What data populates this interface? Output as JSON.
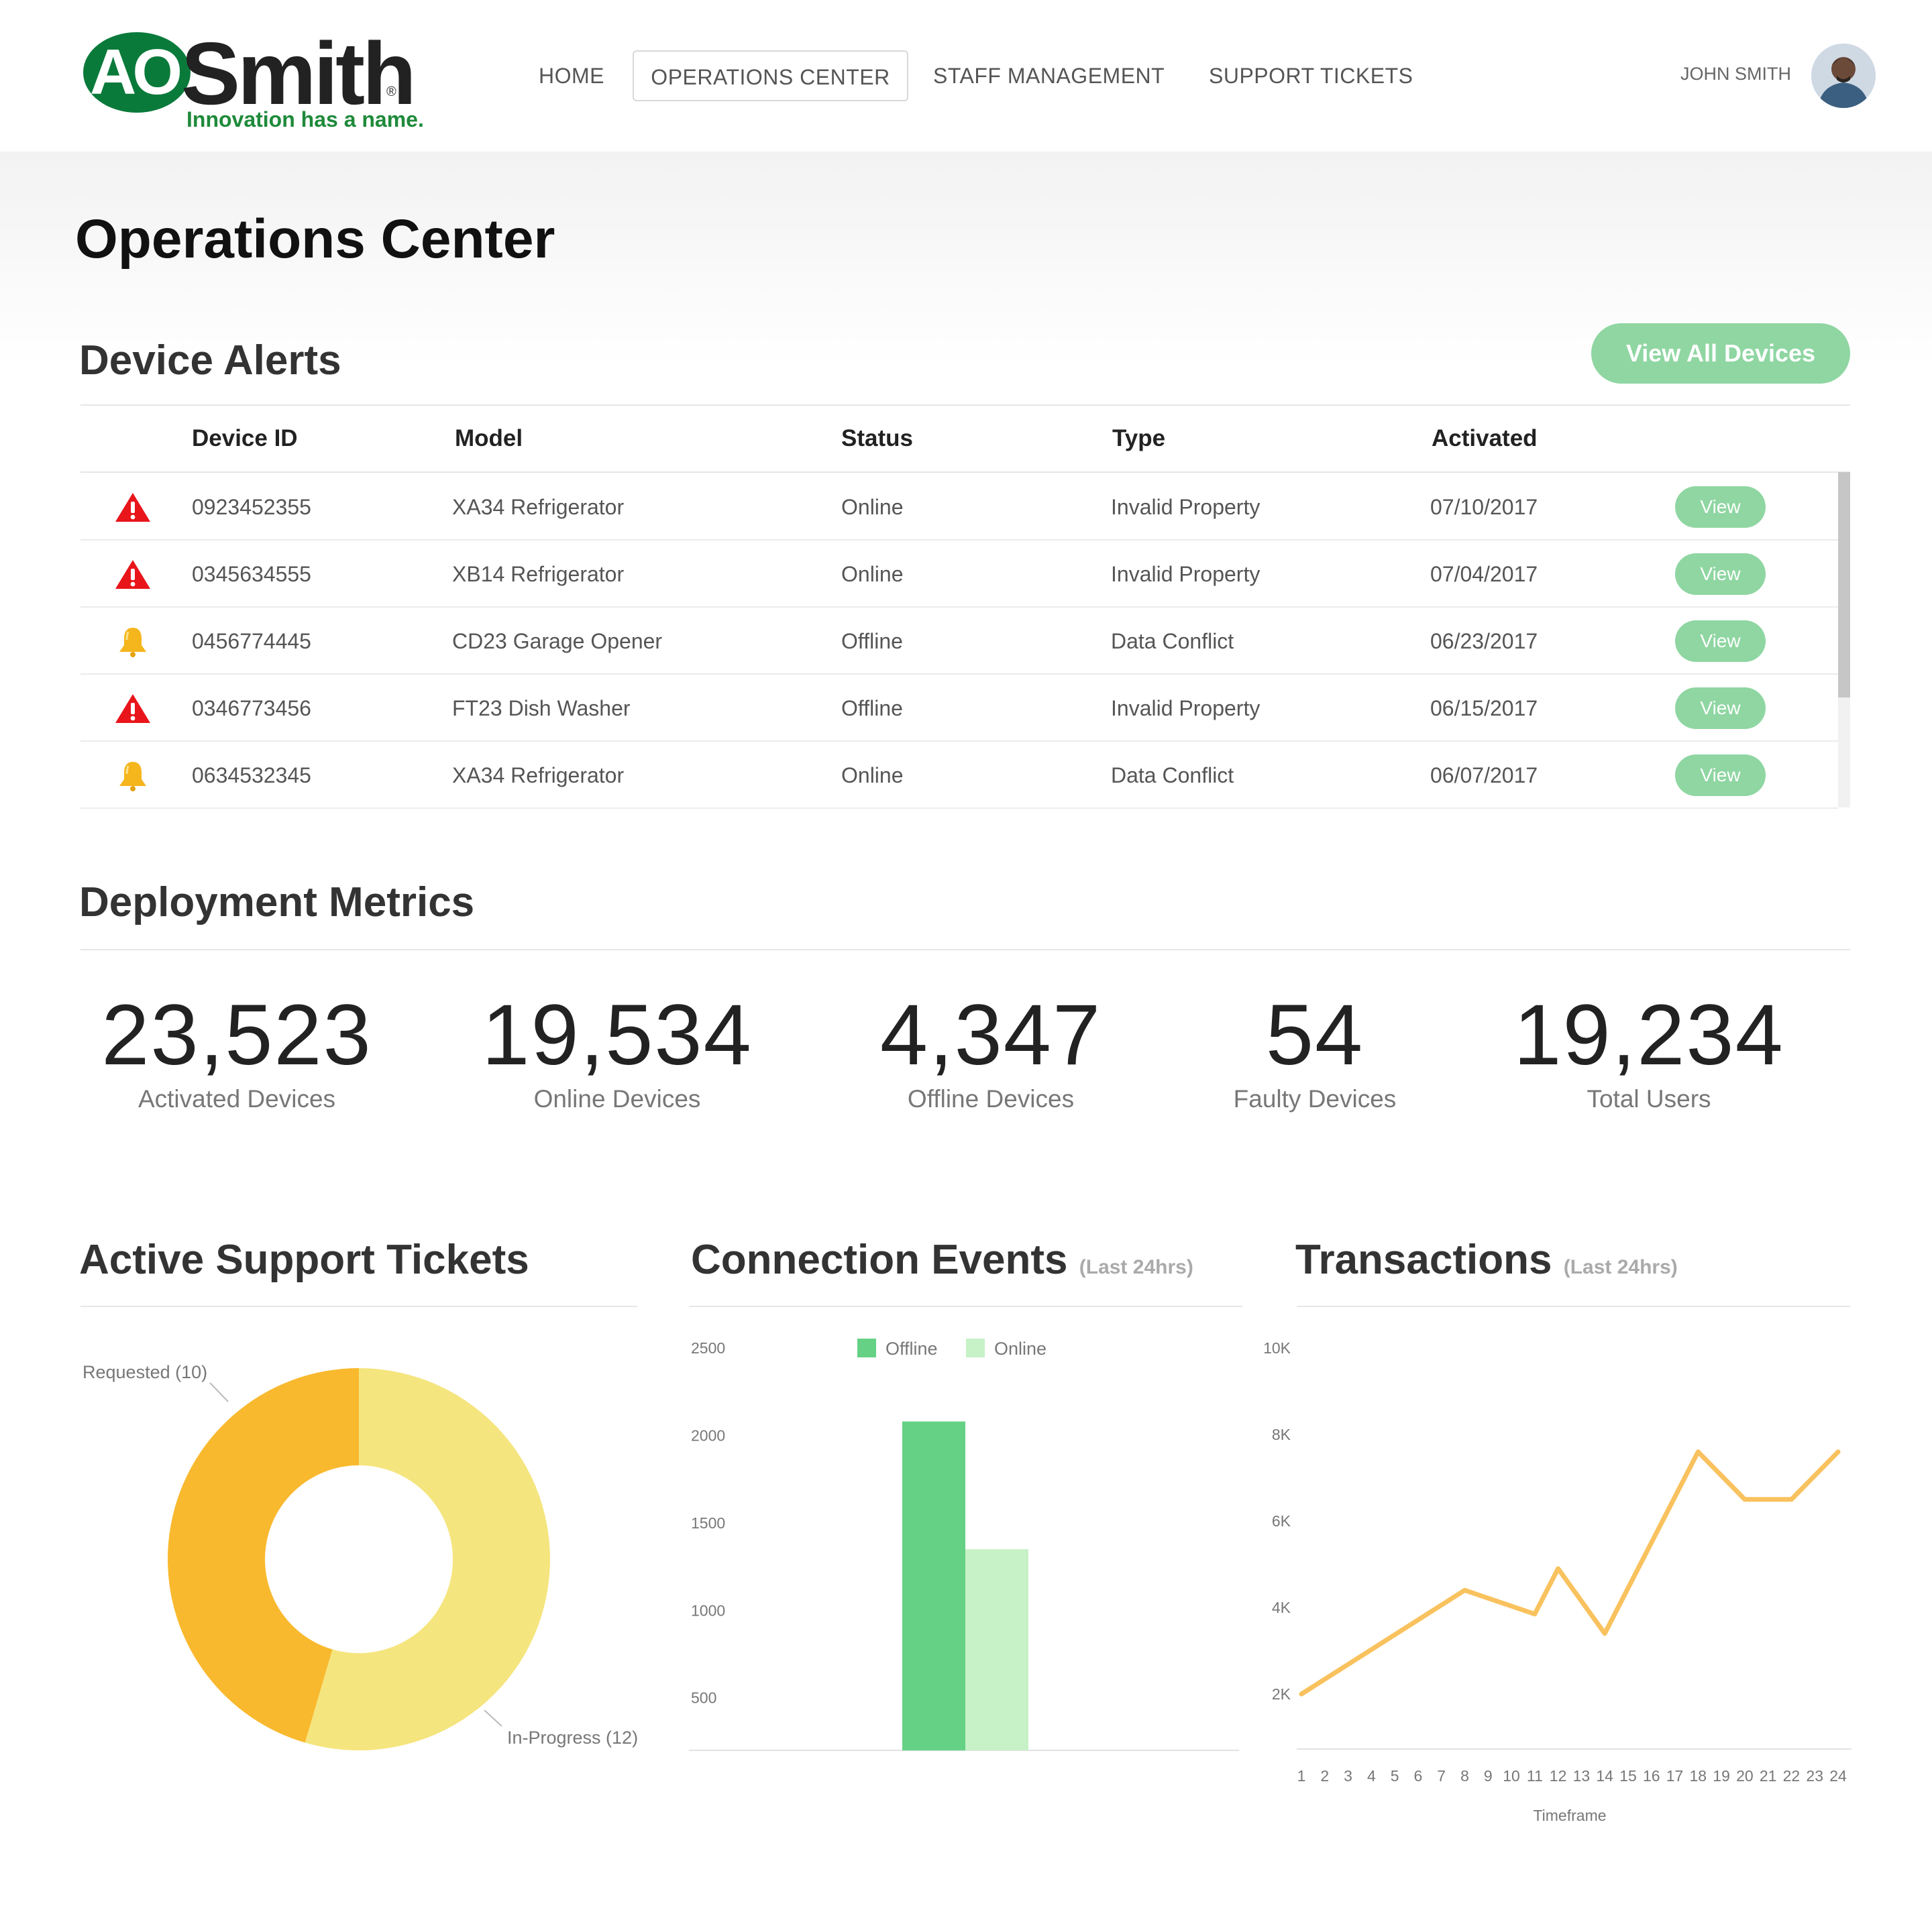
{
  "brand": {
    "logo_badge_text": "AO",
    "logo_word": "Smith",
    "logo_reg": "®",
    "tagline": "Innovation has a name.",
    "green": "#0a7a3b"
  },
  "nav": {
    "items": [
      {
        "label": "HOME",
        "active": false
      },
      {
        "label": "OPERATIONS CENTER",
        "active": true
      },
      {
        "label": "STAFF MANAGEMENT",
        "active": false
      },
      {
        "label": "SUPPORT TICKETS",
        "active": false
      }
    ],
    "user_name": "JOHN SMITH"
  },
  "page": {
    "title": "Operations Center"
  },
  "alerts": {
    "title": "Device Alerts",
    "view_all_label": "View All Devices",
    "columns": [
      "Device ID",
      "Model",
      "Status",
      "Type",
      "Activated"
    ],
    "rows": [
      {
        "icon": "warning-icon",
        "device_id": "0923452355",
        "model": "XA34 Refrigerator",
        "status": "Online",
        "type": "Invalid Property",
        "activated": "07/10/2017",
        "action": "View"
      },
      {
        "icon": "warning-icon",
        "device_id": "0345634555",
        "model": "XB14 Refrigerator",
        "status": "Online",
        "type": "Invalid Property",
        "activated": "07/04/2017",
        "action": "View"
      },
      {
        "icon": "bell-icon",
        "device_id": "0456774445",
        "model": "CD23 Garage Opener",
        "status": "Offline",
        "type": "Data Conflict",
        "activated": "06/23/2017",
        "action": "View"
      },
      {
        "icon": "warning-icon",
        "device_id": "0346773456",
        "model": "FT23 Dish Washer",
        "status": "Offline",
        "type": "Invalid Property",
        "activated": "06/15/2017",
        "action": "View"
      },
      {
        "icon": "bell-icon",
        "device_id": "0634532345",
        "model": "XA34 Refrigerator",
        "status": "Online",
        "type": "Data Conflict",
        "activated": "06/07/2017",
        "action": "View"
      }
    ],
    "colors": {
      "warning": "#e8151b",
      "bell": "#f5b51d",
      "button": "#8fd6a2"
    }
  },
  "metrics": {
    "title": "Deployment Metrics",
    "items": [
      {
        "value": "23,523",
        "label": "Activated Devices"
      },
      {
        "value": "19,534",
        "label": "Online Devices"
      },
      {
        "value": "4,347",
        "label": "Offline Devices"
      },
      {
        "value": "54",
        "label": "Faulty Devices"
      },
      {
        "value": "19,234",
        "label": "Total Users"
      }
    ]
  },
  "tickets": {
    "title": "Active Support Tickets"
  },
  "connection": {
    "title": "Connection Events",
    "subtitle": "(Last 24hrs)"
  },
  "transactions": {
    "title": "Transactions",
    "subtitle": "(Last 24hrs)"
  },
  "chart_data": [
    {
      "type": "pie",
      "title": "Active Support Tickets",
      "labels": [
        "Requested (10)",
        "In-Progress (12)"
      ],
      "values": [
        10,
        12
      ],
      "colors": [
        "#f9b92e",
        "#f5e57e"
      ],
      "donut": true
    },
    {
      "type": "bar",
      "title": "Connection Events",
      "subtitle": "(Last 24hrs)",
      "categories": [
        ""
      ],
      "series": [
        {
          "name": "Offline",
          "values": [
            2080
          ],
          "color": "#65d184"
        },
        {
          "name": "Online",
          "values": [
            1350
          ],
          "color": "#c7f2c7"
        }
      ],
      "yticks": [
        "2500",
        "2000",
        "1500",
        "1000",
        "500"
      ],
      "ylim": [
        200,
        2500
      ],
      "legend": "top"
    },
    {
      "type": "line",
      "title": "Transactions",
      "subtitle": "(Last 24hrs)",
      "xlabel": "Timeframe",
      "x": [
        "1",
        "2",
        "3",
        "4",
        "5",
        "6",
        "7",
        "8",
        "9",
        "10",
        "11",
        "12",
        "13",
        "14",
        "15",
        "16",
        "17",
        "18",
        "19",
        "20",
        "21",
        "22",
        "23",
        "24"
      ],
      "series": [
        {
          "name": "",
          "points": [
            [
              1,
              2000
            ],
            [
              8,
              4400
            ],
            [
              11,
              3850
            ],
            [
              12,
              4900
            ],
            [
              14,
              3400
            ],
            [
              18,
              7600
            ],
            [
              20,
              6500
            ],
            [
              22,
              6500
            ],
            [
              24,
              7600
            ]
          ],
          "color": "#f9c25e"
        }
      ],
      "yticks": [
        "10K",
        "8K",
        "6K",
        "4K",
        "2K"
      ],
      "ylim": [
        0,
        10000
      ],
      "grid": false
    }
  ]
}
